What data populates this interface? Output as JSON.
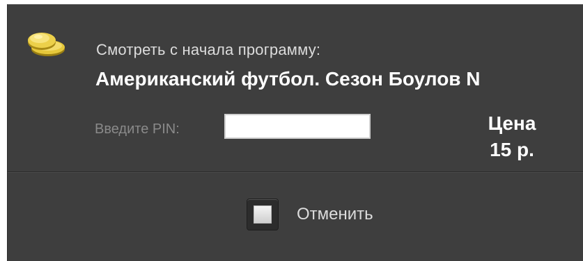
{
  "dialog": {
    "prompt": "Смотреть с начала программу:",
    "program_title": "Американский футбол. Сезон Боулов N",
    "icon": "coins-icon"
  },
  "pin": {
    "label": "Введите PIN:",
    "value": ""
  },
  "price": {
    "label": "Цена",
    "value": "15 р."
  },
  "actions": {
    "cancel_label": "Отменить"
  },
  "colors": {
    "background": "#3e3e3e",
    "text_primary": "#ffffff",
    "text_secondary": "#dcdcdc",
    "text_muted": "#8a8a8a",
    "coin": "#e3c53a"
  }
}
